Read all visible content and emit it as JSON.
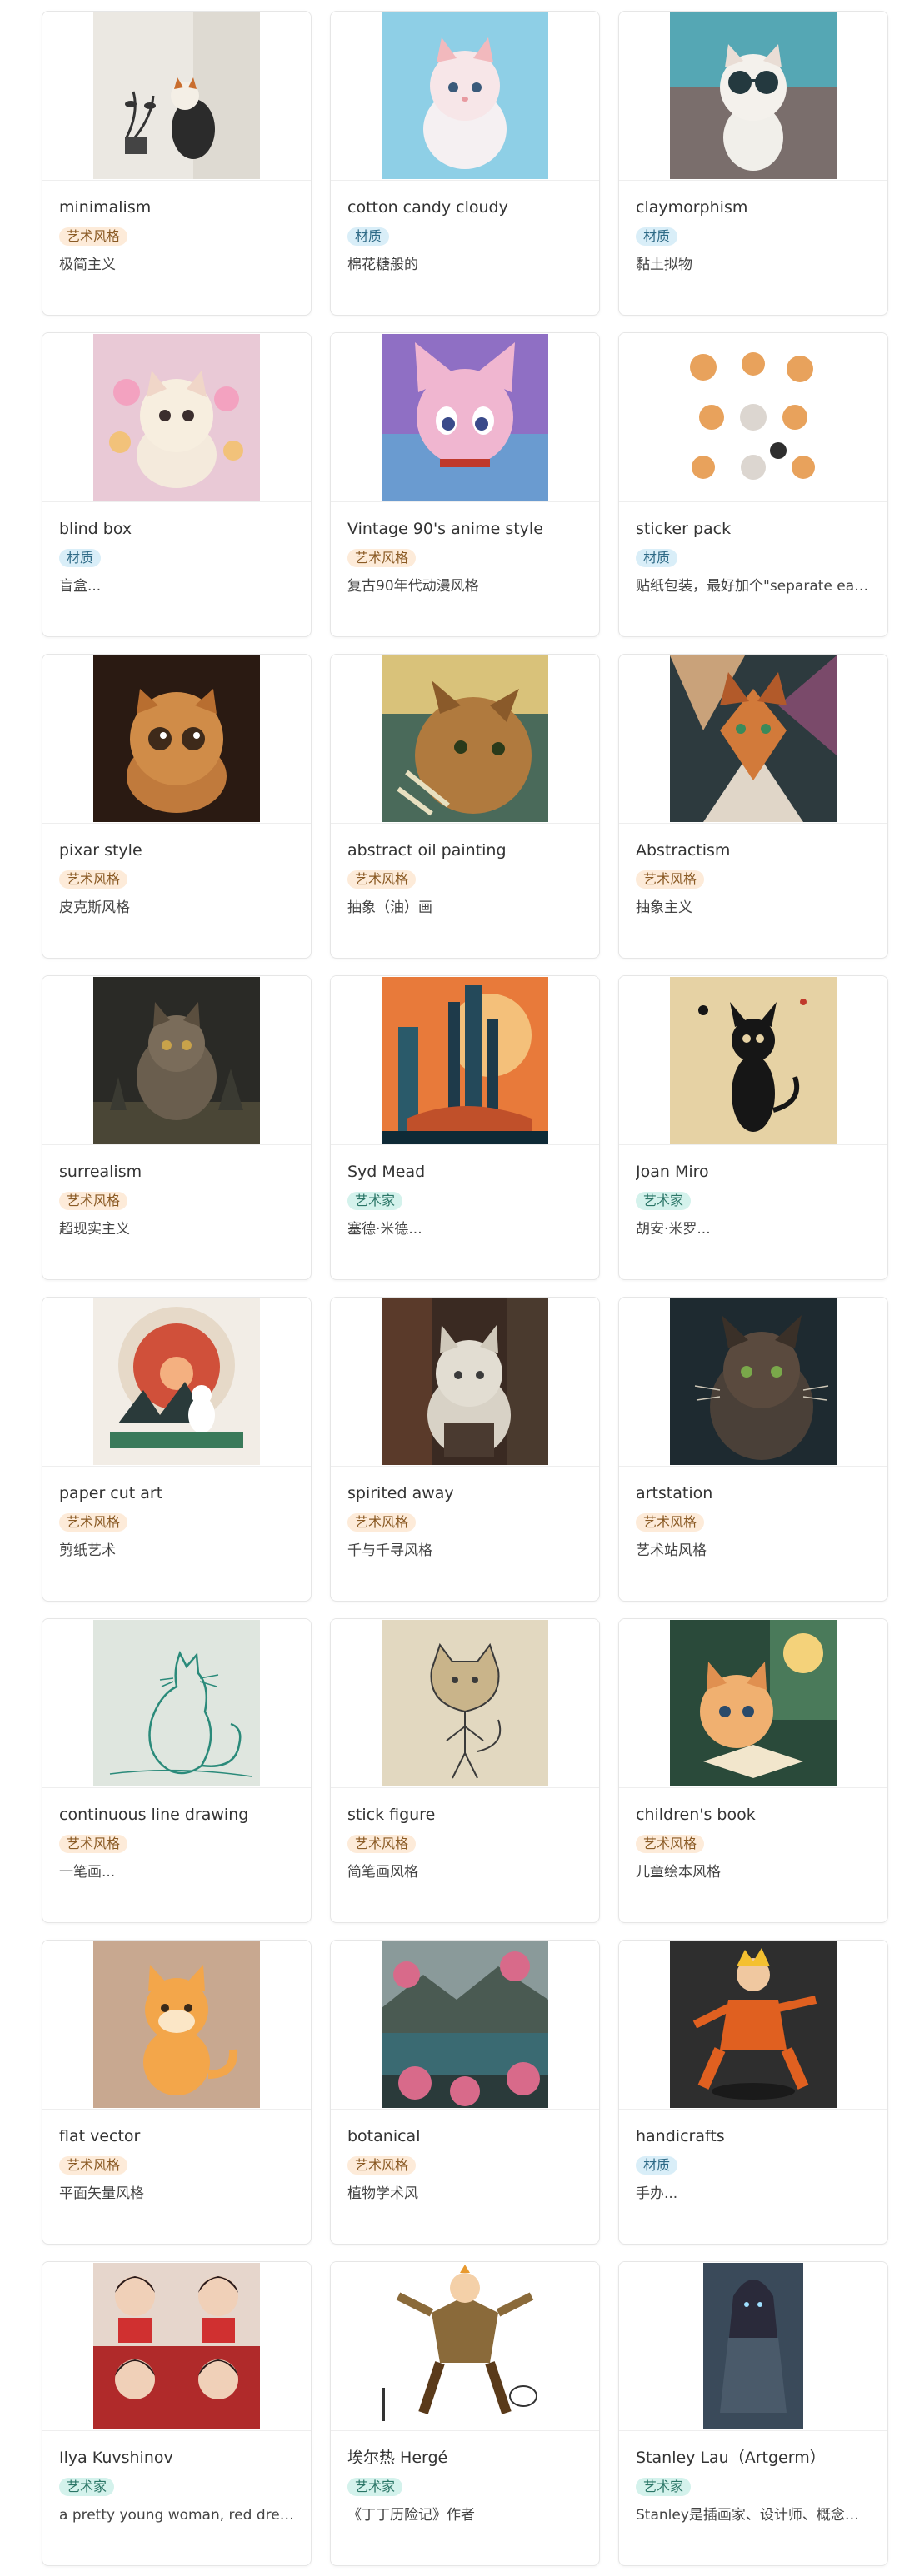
{
  "tag_colors": {
    "art_style": "#fdebd9",
    "material": "#d9eef8",
    "artist": "#d4f2ec"
  },
  "cards": [
    {
      "title": "minimalism",
      "tag": "艺术风格",
      "tag_type": "art",
      "desc": "极简主义",
      "image": "minimalist-cat-icon"
    },
    {
      "title": "cotton candy cloudy",
      "tag": "材质",
      "tag_type": "mat",
      "desc": "棉花糖般的",
      "image": "cotton-candy-cat-icon"
    },
    {
      "title": "claymorphism",
      "tag": "材质",
      "tag_type": "mat",
      "desc": "黏土拟物",
      "image": "clay-cat-icon"
    },
    {
      "title": "blind box",
      "tag": "材质",
      "tag_type": "mat",
      "desc": "盲盒...",
      "image": "blind-box-cat-icon"
    },
    {
      "title": "Vintage 90's anime style",
      "tag": "艺术风格",
      "tag_type": "art",
      "desc": "复古90年代动漫风格",
      "image": "anime-cat-icon"
    },
    {
      "title": "sticker pack",
      "tag": "材质",
      "tag_type": "mat",
      "desc": "贴纸包装，最好加个\"separate each ...",
      "image": "sticker-cats-icon"
    },
    {
      "title": "pixar style",
      "tag": "艺术风格",
      "tag_type": "art",
      "desc": "皮克斯风格",
      "image": "pixar-cat-icon"
    },
    {
      "title": "abstract oil painting",
      "tag": "艺术风格",
      "tag_type": "art",
      "desc": "抽象（油）画",
      "image": "oil-painting-cat-icon"
    },
    {
      "title": "Abstractism",
      "tag": "艺术风格",
      "tag_type": "art",
      "desc": "抽象主义",
      "image": "abstract-cat-icon"
    },
    {
      "title": "surrealism",
      "tag": "艺术风格",
      "tag_type": "art",
      "desc": "超现实主义",
      "image": "surreal-cat-icon"
    },
    {
      "title": " Syd Mead",
      "tag": "艺术家",
      "tag_type": "artist",
      "desc": "塞德·米德...",
      "image": "syd-mead-city-icon"
    },
    {
      "title": "Joan Miro",
      "tag": "艺术家",
      "tag_type": "artist",
      "desc": "胡安·米罗...",
      "image": "miro-cat-icon"
    },
    {
      "title": "paper cut art",
      "tag": "艺术风格",
      "tag_type": "art",
      "desc": "剪纸艺术",
      "image": "paper-cut-cat-icon"
    },
    {
      "title": "spirited away",
      "tag": "艺术风格",
      "tag_type": "art",
      "desc": "千与千寻风格",
      "image": "spirited-away-cat-icon"
    },
    {
      "title": "artstation",
      "tag": "艺术风格",
      "tag_type": "art",
      "desc": "艺术站风格",
      "image": "artstation-cat-icon"
    },
    {
      "title": "continuous line drawing",
      "tag": "艺术风格",
      "tag_type": "art",
      "desc": "一笔画...",
      "image": "line-drawing-cat-icon"
    },
    {
      "title": "stick figure",
      "tag": "艺术风格",
      "tag_type": "art",
      "desc": "简笔画风格",
      "image": "stick-figure-cat-icon"
    },
    {
      "title": "children's book",
      "tag": "艺术风格",
      "tag_type": "art",
      "desc": "儿童绘本风格",
      "image": "childrens-book-cat-icon"
    },
    {
      "title": "flat vector",
      "tag": "艺术风格",
      "tag_type": "art",
      "desc": "平面矢量风格",
      "image": "flat-vector-cat-icon"
    },
    {
      "title": "botanical",
      "tag": "艺术风格",
      "tag_type": "art",
      "desc": "植物学术风",
      "image": "botanical-landscape-icon"
    },
    {
      "title": "handicrafts",
      "tag": "材质",
      "tag_type": "mat",
      "desc": "手办...",
      "image": "figurine-icon"
    },
    {
      "title": "Ilya Kuvshinov",
      "tag": "艺术家",
      "tag_type": "artist",
      "desc": "a pretty young woman, red dress, ...",
      "image": "kuvshinov-portraits-icon"
    },
    {
      "title": "埃尔热 Hergé",
      "tag": "艺术家",
      "tag_type": "artist",
      "desc": "《丁丁历险记》作者",
      "image": "tintin-icon"
    },
    {
      "title": "Stanley Lau（Artgerm）",
      "tag": "艺术家",
      "tag_type": "artist",
      "desc": "Stanley是插画家、设计师、概念艺...",
      "image": "artgerm-warrior-icon"
    }
  ]
}
